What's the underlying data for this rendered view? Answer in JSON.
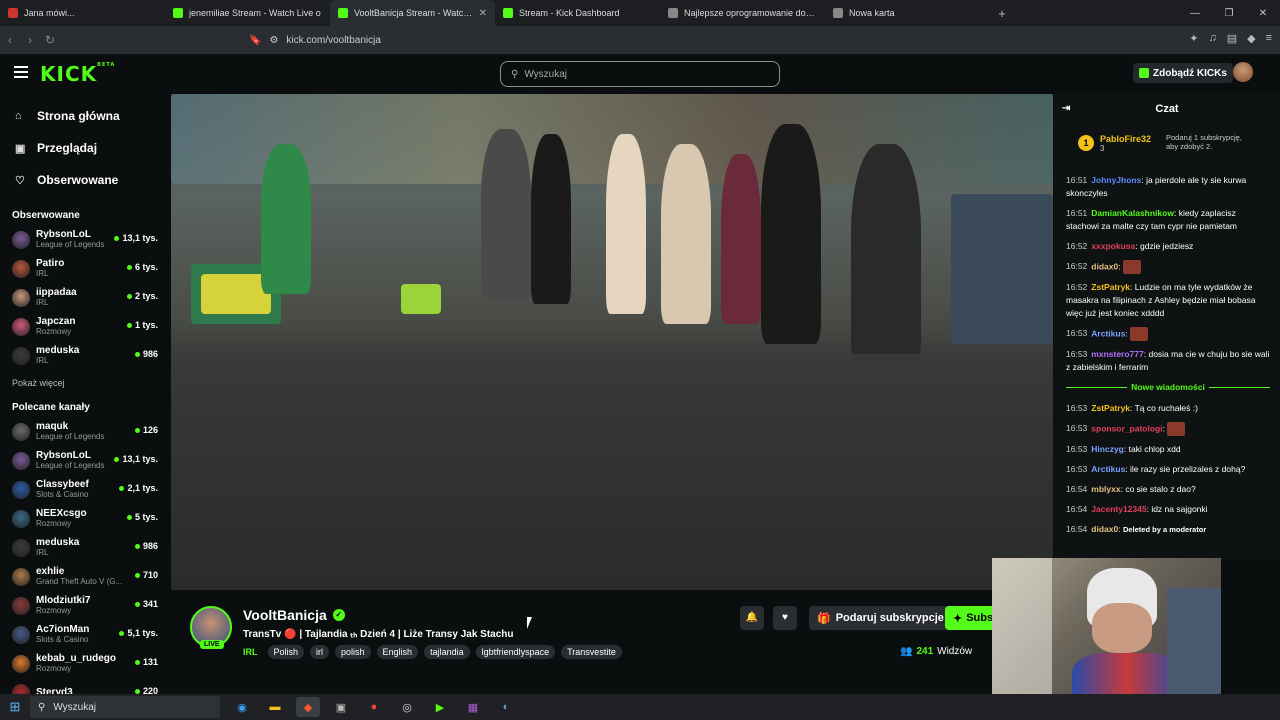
{
  "browser": {
    "tabs": [
      {
        "title": "Jana mówi...",
        "color": "#c33"
      },
      {
        "title": "jenemiliae Stream - Watch Live o",
        "color": "#53fc18"
      },
      {
        "title": "VooltBanicja Stream - Watch l",
        "color": "#53fc18"
      },
      {
        "title": "Stream - Kick Dashboard",
        "color": "#53fc18"
      },
      {
        "title": "Najlepsze oprogramowanie do ulepsz",
        "color": "#888"
      },
      {
        "title": "Nowa karta",
        "color": "#888"
      }
    ],
    "new_tab": "+",
    "url": "kick.com/vooltbanicja"
  },
  "header": {
    "logo": "KICK",
    "logo_badge": "BETA",
    "search_placeholder": "Wyszukaj",
    "kicks_button": "Zdobądź KICKs"
  },
  "sidebar": {
    "nav": [
      {
        "label": "Strona główna",
        "icon": "home-icon"
      },
      {
        "label": "Przeglądaj",
        "icon": "browse-icon"
      },
      {
        "label": "Obserwowane",
        "icon": "heart-icon"
      }
    ],
    "followed_title": "Obserwowane",
    "followed": [
      {
        "name": "RybsonLoL",
        "game": "League of Legends",
        "viewers": "13,1 tys.",
        "color": "#7a5a9a"
      },
      {
        "name": "Patiro",
        "game": "IRL",
        "viewers": "6 tys.",
        "color": "#b8563a"
      },
      {
        "name": "iippadaa",
        "game": "IRL",
        "viewers": "2 tys.",
        "color": "#c89a7a"
      },
      {
        "name": "Japczan",
        "game": "Rozmowy",
        "viewers": "1 tys.",
        "color": "#d2587a"
      },
      {
        "name": "meduska",
        "game": "IRL",
        "viewers": "986",
        "color": "#3a3a3a"
      }
    ],
    "show_more": "Pokaż więcej",
    "recommended_title": "Polecane kanały",
    "recommended": [
      {
        "name": "maquk",
        "game": "League of Legends",
        "viewers": "126",
        "color": "#6b6b6b"
      },
      {
        "name": "RybsonLoL",
        "game": "League of Legends",
        "viewers": "13,1 tys.",
        "color": "#7a5a9a"
      },
      {
        "name": "Classybeef",
        "game": "Slots & Casino",
        "viewers": "2,1 tys.",
        "color": "#2a5aa8"
      },
      {
        "name": "NEEXcsgo",
        "game": "Rozmowy",
        "viewers": "5 tys.",
        "color": "#3a6a8a"
      },
      {
        "name": "meduska",
        "game": "IRL",
        "viewers": "986",
        "color": "#3a3a3a"
      },
      {
        "name": "exhlie",
        "game": "Grand Theft Auto V (G...",
        "viewers": "710",
        "color": "#b07a4a"
      },
      {
        "name": "Mlodziutki7",
        "game": "Rozmowy",
        "viewers": "341",
        "color": "#8a3a3a"
      },
      {
        "name": "Ac7ionMan",
        "game": "Slots & Casino",
        "viewers": "5,1 tys.",
        "color": "#4a5a8a"
      },
      {
        "name": "kebab_u_rudego",
        "game": "Rozmowy",
        "viewers": "131",
        "color": "#e07a2a"
      },
      {
        "name": "Steryd3",
        "game": "",
        "viewers": "220",
        "color": "#aa2a2a"
      }
    ]
  },
  "stream": {
    "name": "VooltBanicja",
    "live": "LIVE",
    "title": "TransTv 🔴 | Tajlandia ₜₕ Dzień 4 | Liże Transy Jak Stachu",
    "category": "IRL",
    "tags": [
      "Polish",
      "irl",
      "polish",
      "English",
      "tajlandia",
      "lgbtfriendlyspace",
      "Transvestite"
    ],
    "gift_sub": "Podaruj subskrypcje",
    "subscribe": "Subs",
    "viewers_count": "241",
    "viewers_label": "Widzów"
  },
  "chat": {
    "title": "Czat",
    "pinned": {
      "rank": "1",
      "user": "PabloFire32",
      "count": "3",
      "gift_text": "Podaruj 1 subskrypcję, aby zdobyć 2."
    },
    "messages_before": [
      {
        "time": "16:51",
        "user": "JohnyJhons",
        "color": "#5a8cff",
        "text": "ja pierdole ale ty sie kurwa skonczyles"
      },
      {
        "time": "16:51",
        "user": "DamianKalashnikow",
        "color": "#53fc18",
        "text": "kiedy zaplacisz stachowi za malte czy tam cypr nie pamietam"
      },
      {
        "time": "16:52",
        "user": "xxxpokusa",
        "color": "#e0405a",
        "text": "gdzie jedziesz"
      },
      {
        "time": "16:52",
        "user": "didax0",
        "color": "#e0c080",
        "text": ""
      },
      {
        "time": "16:52",
        "user": "ZstPatryk",
        "color": "#f2c21b",
        "text": "Ludzie on ma tyle wydatków że masakra na filipinach z Ashley będzie miał bobasa więc już jest koniec xdddd"
      },
      {
        "time": "16:53",
        "user": "Arctikus",
        "color": "#7aa0ff",
        "text": ""
      },
      {
        "time": "16:53",
        "user": "mxnstero777",
        "color": "#b070ff",
        "text": "dosia ma cie w chuju bo sie wali z zabielskim i ferrarim"
      }
    ],
    "new_messages": "Nowe wiadomości",
    "messages_after": [
      {
        "time": "16:53",
        "user": "ZstPatryk",
        "color": "#f2c21b",
        "text": "Tą co ruchałeś :)"
      },
      {
        "time": "16:53",
        "user": "sponsor_patologi",
        "color": "#e0405a",
        "text": ""
      },
      {
        "time": "16:53",
        "user": "Hinczyg",
        "color": "#7aa0ff",
        "text": "taki chlop xdd"
      },
      {
        "time": "16:53",
        "user": "Arctikus",
        "color": "#7aa0ff",
        "text": "ile razy sie przelizales z dohą?"
      },
      {
        "time": "16:54",
        "user": "mblyxx",
        "color": "#e0c080",
        "text": "co sie stalo z dao?"
      },
      {
        "time": "16:54",
        "user": "Jacenty12345",
        "color": "#e0405a",
        "text": "idz na sajgonki"
      },
      {
        "time": "16:54",
        "user": "didax0",
        "color": "#e0c080",
        "text": "Deleted by a moderator"
      }
    ]
  },
  "taskbar": {
    "search": "Wyszukaj"
  }
}
